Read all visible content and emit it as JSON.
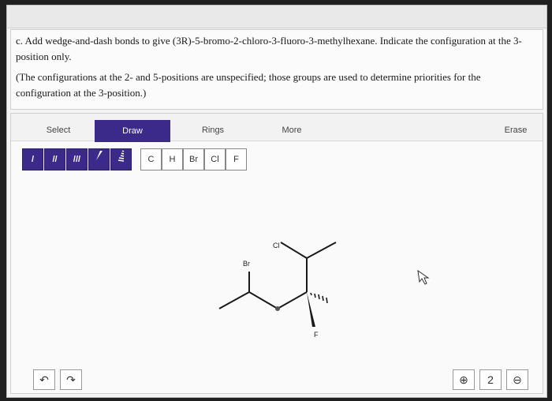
{
  "question": {
    "line1": "c. Add wedge-and-dash bonds to give (3R)-5-bromo-2-chloro-3-fluoro-3-methylhexane. Indicate the configuration at the 3-position only.",
    "line2": "(The configurations at the 2- and 5-positions are unspecified; those groups are used to determine priorities for the configuration at the 3-position.)"
  },
  "tabs": {
    "select": "Select",
    "draw": "Draw",
    "rings": "Rings",
    "more": "More",
    "erase": "Erase"
  },
  "bond_tools": [
    "/",
    "//",
    "///",
    "wedge",
    "dash"
  ],
  "atom_tools": [
    "C",
    "H",
    "Br",
    "Cl",
    "F"
  ],
  "atoms": {
    "br": "Br",
    "cl": "Cl",
    "f": "F"
  },
  "controls": {
    "undo": "↶",
    "redo": "↷",
    "zoom_in": "⊕",
    "zoom_reset": "2",
    "zoom_out": "⊖"
  },
  "colors": {
    "accent": "#3b2a8a"
  }
}
